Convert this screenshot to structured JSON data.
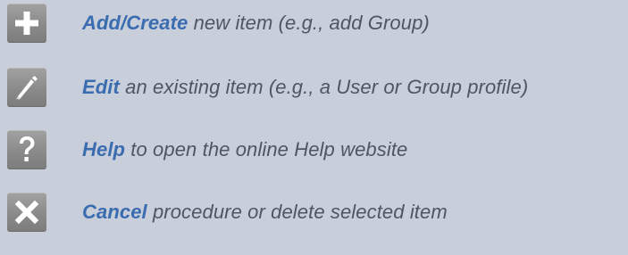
{
  "legend": {
    "items": [
      {
        "icon": "plus-icon",
        "keyword": "Add/Create",
        "text": " new item (e.g., add Group)"
      },
      {
        "icon": "pencil-icon",
        "keyword": "Edit",
        "text": " an existing item (e.g., a User or Group profile)"
      },
      {
        "icon": "question-mark-icon",
        "keyword": "Help",
        "text": " to open the online Help website"
      },
      {
        "icon": "close-icon",
        "keyword": "Cancel",
        "text": " procedure or delete selected item"
      }
    ]
  },
  "colors": {
    "background": "#c9cedb",
    "icon_button": "#8c8c8c",
    "keyword": "#3a6cb0",
    "description": "#4f5563"
  }
}
